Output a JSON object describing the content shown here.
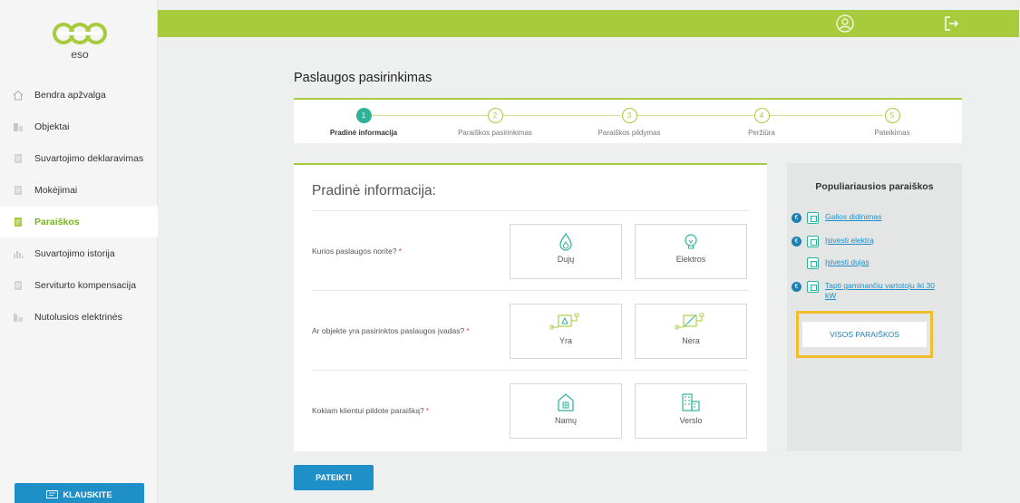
{
  "brand": {
    "logo_text": "eso",
    "accent": "#a7cb3d",
    "primary": "#1f8fc8",
    "teal": "#2eb398"
  },
  "sidebar": {
    "items": [
      {
        "label": "Bendra apžvalga",
        "icon": "home-icon"
      },
      {
        "label": "Objektai",
        "icon": "building-icon"
      },
      {
        "label": "Suvartojimo deklaravimas",
        "icon": "document-icon"
      },
      {
        "label": "Mokėjimai",
        "icon": "document-icon"
      },
      {
        "label": "Paraiškos",
        "icon": "application-icon",
        "active": true
      },
      {
        "label": "Suvartojimo istorija",
        "icon": "bar-chart-icon"
      },
      {
        "label": "Serviturto kompensacija",
        "icon": "document-icon"
      },
      {
        "label": "Nutolusios elektrinės",
        "icon": "power-plant-icon"
      }
    ],
    "ask_button": "KLAUSKITE"
  },
  "page": {
    "title": "Paslaugos pasirinkimas"
  },
  "stepper": [
    {
      "num": "1",
      "label": "Pradinė informacija",
      "active": true
    },
    {
      "num": "2",
      "label": "Paraiškos pasirinkimas"
    },
    {
      "num": "3",
      "label": "Paraiškos pildymas"
    },
    {
      "num": "4",
      "label": "Peržiūra"
    },
    {
      "num": "5",
      "label": "Pateikimas"
    }
  ],
  "form": {
    "title": "Pradinė informacija:",
    "rows": [
      {
        "question": "Kurios paslaugos norite?",
        "required": "*",
        "options": [
          "Dujų",
          "Elektros"
        ]
      },
      {
        "question": "Ar objekte yra pasirinktos paslaugos įvadas?",
        "required": "*",
        "options": [
          "Yra",
          "Nėra"
        ]
      },
      {
        "question": "Kokiam klientui pildote paraišką?",
        "required": "*",
        "options": [
          "Namų",
          "Verslo"
        ]
      }
    ]
  },
  "popular": {
    "title": "Populiariausios paraiškos",
    "items": [
      {
        "label": "Galios didinimas",
        "paid": true
      },
      {
        "label": "Įsivesti elektrą",
        "paid": true
      },
      {
        "label": "Įsivesti dujas",
        "paid": false
      },
      {
        "label": "Tapti gaminančiu vartotoju iki 30 kW",
        "paid": true
      }
    ],
    "all_button": "VISOS PARAIŠKOS"
  },
  "submit_label": "PATEIKTI"
}
